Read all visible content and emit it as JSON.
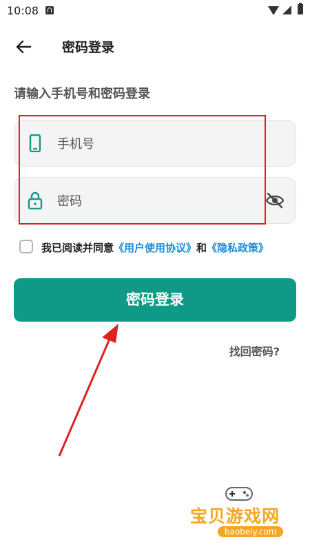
{
  "status_bar": {
    "time": "10:08",
    "notification_icon": "a-notification-icon",
    "icons": [
      "wifi-icon",
      "signal-icon",
      "battery-icon"
    ]
  },
  "app_bar": {
    "title": "密码登录",
    "back_icon": "arrow-left-icon"
  },
  "instruction": "请输入手机号和密码登录",
  "phone_field": {
    "placeholder": "手机号",
    "icon": "phone-icon",
    "value": ""
  },
  "password_field": {
    "placeholder": "密码",
    "icon": "lock-icon",
    "toggle_icon": "eye-off-icon",
    "value": ""
  },
  "agreement": {
    "checked": false,
    "prefix": "我已阅读并同意",
    "user_agreement": "《用户使用协议》",
    "conjunction": "和",
    "privacy_policy": "《隐私政策》"
  },
  "login_button": {
    "label": "密码登录"
  },
  "forgot_password": "找回密码?",
  "watermark": {
    "text": "宝贝游戏网",
    "url": "baobeiy.com"
  },
  "colors": {
    "accent": "#0f9a88",
    "link": "#1a8cd8",
    "annotation": "#e02020",
    "watermark": "#f5a623"
  }
}
